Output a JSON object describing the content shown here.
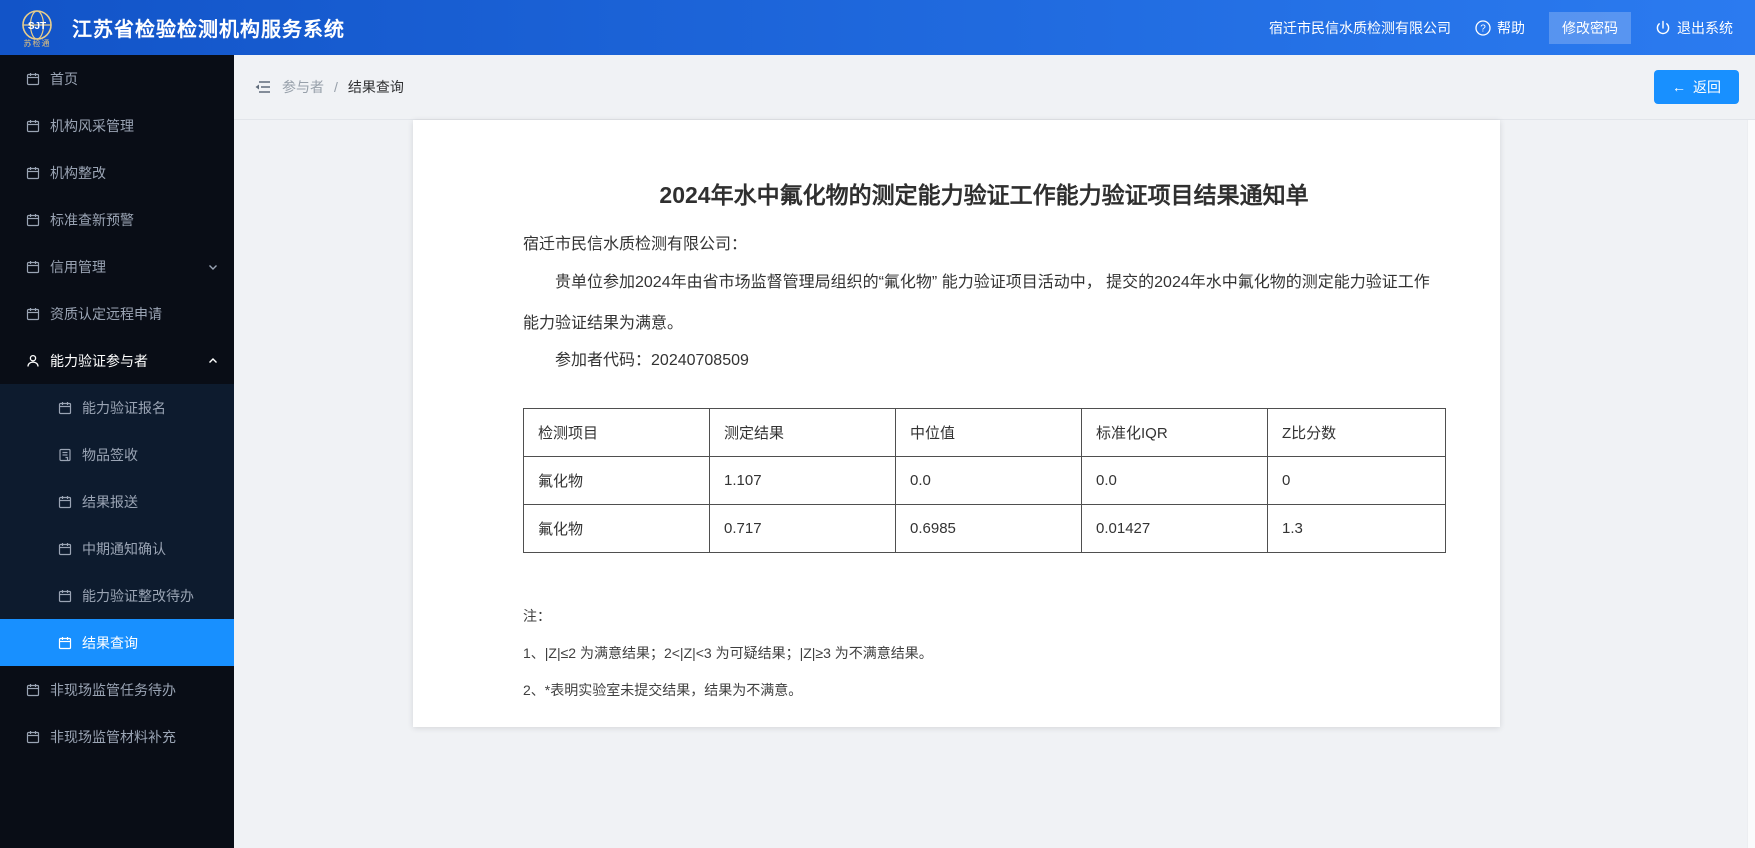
{
  "colors": {
    "accent": "#1890ff",
    "header_grad_a": "#1254c8",
    "header_grad_b": "#2b7bf0",
    "sidebar_bg": "#090d16",
    "submenu_bg": "#0d1b2e",
    "sidebar_text": "#9aa4b4",
    "content_bg": "#f0f2f5",
    "table_border": "#4f4f4f",
    "gold": "#e4c27c"
  },
  "header": {
    "logo_abbr": "SJT",
    "logo_sub": "苏检通",
    "title": "江苏省检验检测机构服务系统",
    "company": "宿迁市民信水质检测有限公司",
    "help_label": "帮助",
    "change_password_label": "修改密码",
    "logout_label": "退出系统"
  },
  "sidebar": {
    "items_top": [
      {
        "label": "首页"
      },
      {
        "label": "机构风采管理"
      },
      {
        "label": "机构整改"
      },
      {
        "label": "标准查新预警"
      },
      {
        "label": "信用管理"
      },
      {
        "label": "资质认定远程申请"
      },
      {
        "label": "能力验证参与者"
      }
    ],
    "submenu_items": [
      {
        "label": "能力验证报名"
      },
      {
        "label": "物品签收"
      },
      {
        "label": "结果报送"
      },
      {
        "label": "中期通知确认"
      },
      {
        "label": "能力验证整改待办"
      },
      {
        "label": "结果查询"
      }
    ],
    "items_bottom": [
      {
        "label": "非现场监管任务待办"
      },
      {
        "label": "非现场监管材料补充"
      }
    ],
    "active_item": "结果查询",
    "expanded_group": "能力验证参与者"
  },
  "breadcrumb": {
    "parent": "参与者",
    "separator": "/",
    "current": "结果查询"
  },
  "toolbar": {
    "back_label": "返回",
    "back_arrow": "←"
  },
  "document": {
    "title": "2024年水中氟化物的测定能力验证工作能力验证项目结果通知单",
    "salutation": "宿迁市民信水质检测有限公司：",
    "body": "贵单位参加2024年由省市场监督管理局组织的“氟化物” 能力验证项目活动中， 提交的2024年水中氟化物的测定能力验证工作能力验证结果为满意。",
    "participant_code_label": "参加者代码：",
    "participant_code": "20240708509",
    "table": {
      "headers": [
        "检测项目",
        "测定结果",
        "中位值",
        "标准化IQR",
        "Z比分数"
      ],
      "rows": [
        [
          "氟化物",
          "1.107",
          "0.0",
          "0.0",
          "0"
        ],
        [
          "氟化物",
          "0.717",
          "0.6985",
          "0.01427",
          "1.3"
        ]
      ]
    },
    "notes_title": "注：",
    "notes": [
      "1、|Z|≤2 为满意结果；2<|Z|<3 为可疑结果；|Z|≥3 为不满意结果。",
      "2、*表明实验室未提交结果，结果为不满意。"
    ]
  }
}
